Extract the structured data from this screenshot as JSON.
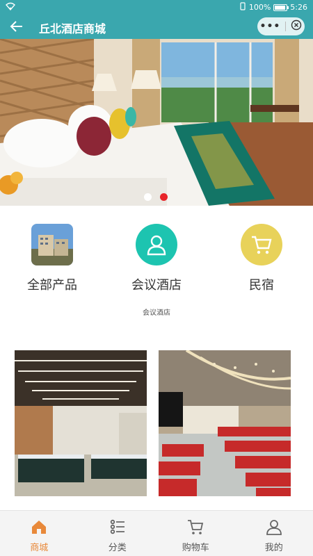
{
  "status_bar": {
    "battery": "100%",
    "time": "5:26"
  },
  "header": {
    "title": "丘北酒店商城",
    "capsule_more": "•••"
  },
  "banner": {
    "slides": 2,
    "active_slide": 2
  },
  "categories": [
    {
      "label": "全部产品",
      "icon": "hotel-photo-icon"
    },
    {
      "label": "会议酒店",
      "icon": "person-icon"
    },
    {
      "label": "民宿",
      "icon": "cart-icon"
    }
  ],
  "section_caption": "会议酒店",
  "products": [
    {
      "image": "conference-hall-photo"
    },
    {
      "image": "auditorium-photo"
    }
  ],
  "tabbar": {
    "active": 0,
    "tabs": [
      {
        "label": "商城",
        "icon": "home-icon"
      },
      {
        "label": "分类",
        "icon": "list-icon"
      },
      {
        "label": "购物车",
        "icon": "cart-icon"
      },
      {
        "label": "我的",
        "icon": "user-icon"
      }
    ]
  },
  "colors": {
    "theme": "#3aa7ae",
    "active_tab": "#e8893a",
    "dot_active": "#e8242a",
    "teal_circle": "#1dc4b0",
    "yellow_circle": "#e8d25a"
  }
}
